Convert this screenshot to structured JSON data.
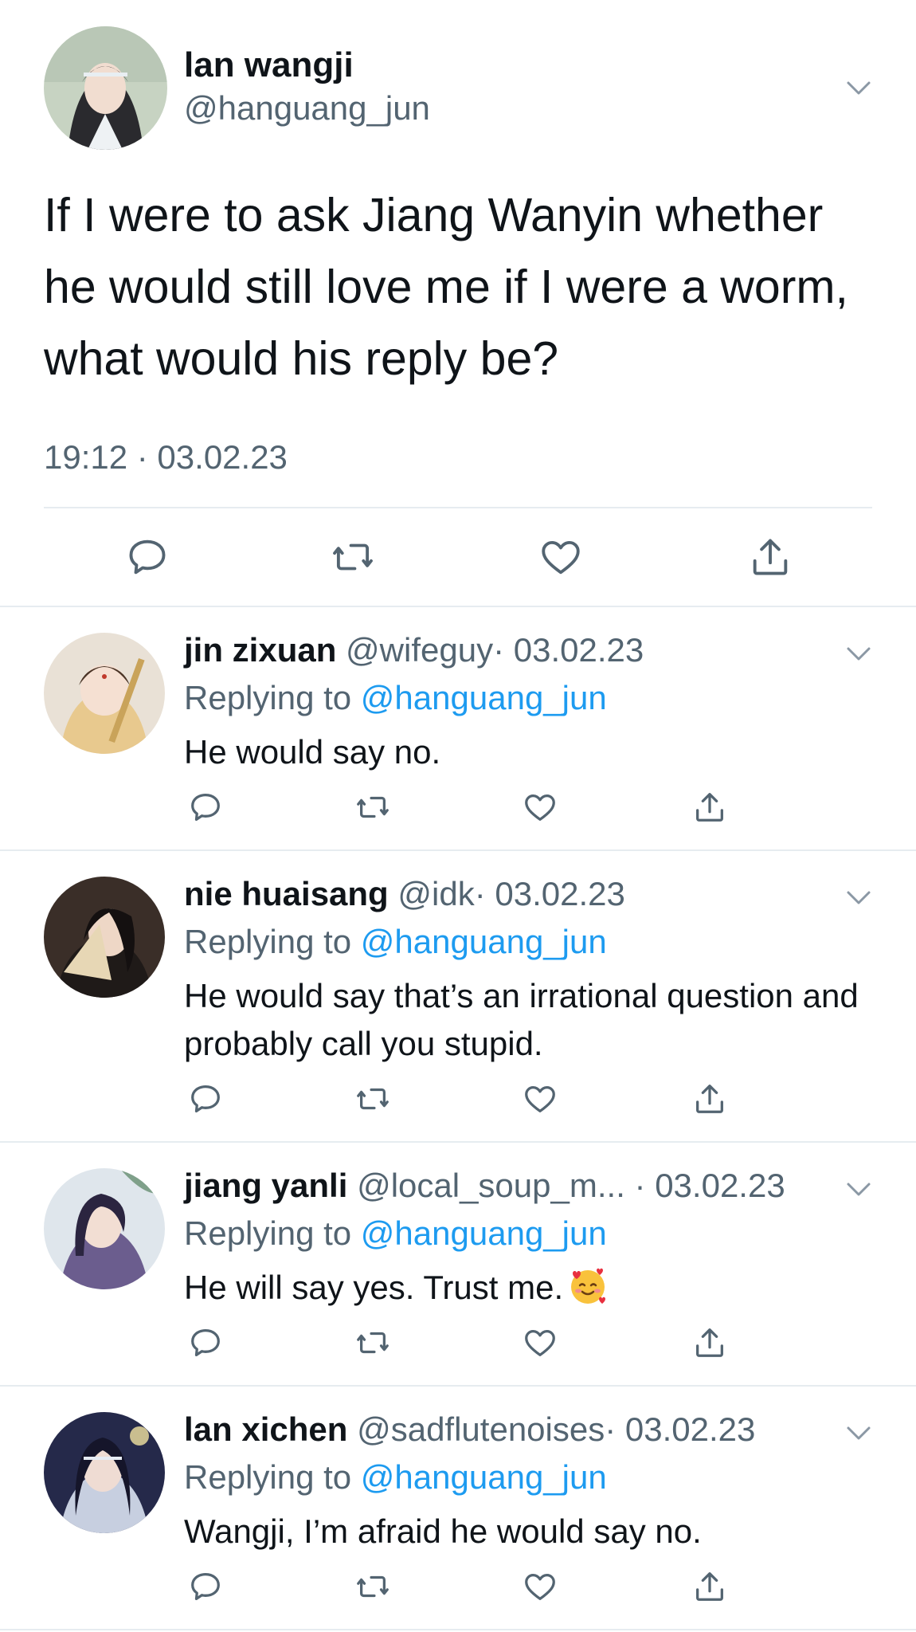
{
  "main": {
    "name": "lan wangji",
    "handle": "@hanguang_jun",
    "text": "If I were to ask Jiang Wanyin whether he would still love me if I were a worm, what would his reply be?",
    "time": "19:12 · 03.02.23"
  },
  "replies": [
    {
      "name": "jin zixuan",
      "handle": "@wifeguy",
      "date": "· 03.02.23",
      "replying_label": "Replying to",
      "replying_to": "@hanguang_jun",
      "text": "He would say no."
    },
    {
      "name": "nie huaisang",
      "handle": "@idk",
      "date": "· 03.02.23",
      "replying_label": "Replying to",
      "replying_to": "@hanguang_jun",
      "text": "He would say that’s an irrational question and probably call you stupid."
    },
    {
      "name": "jiang yanli",
      "handle": "@local_soup_m...",
      "date": "· 03.02.23",
      "replying_label": "Replying to",
      "replying_to": "@hanguang_jun",
      "text": "He will say yes. Trust me.",
      "emoji": "smiling-face-with-hearts"
    },
    {
      "name": "lan xichen",
      "handle": "@sadflutenoises",
      "date": "· 03.02.23",
      "replying_label": "Replying to",
      "replying_to": "@hanguang_jun",
      "text": "Wangji, I’m afraid he would say no."
    }
  ],
  "icons": {
    "reply": "speech-bubble-icon",
    "retweet": "retweet-icon",
    "like": "heart-icon",
    "share": "share-icon",
    "menu": "chevron-down-icon"
  },
  "colors": {
    "text": "#0f1419",
    "secondary": "#536471",
    "link": "#1d9bf0",
    "divider": "#e6ecf0"
  }
}
